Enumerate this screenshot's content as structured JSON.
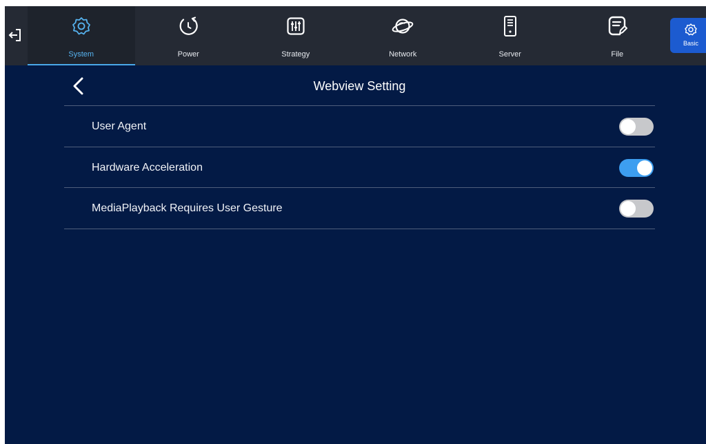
{
  "nav": {
    "items": [
      {
        "label": "System",
        "icon": "gear-icon",
        "active": true
      },
      {
        "label": "Power",
        "icon": "power-clock-icon",
        "active": false
      },
      {
        "label": "Strategy",
        "icon": "sliders-icon",
        "active": false
      },
      {
        "label": "Network",
        "icon": "globe-network-icon",
        "active": false
      },
      {
        "label": "Server",
        "icon": "server-icon",
        "active": false
      },
      {
        "label": "File",
        "icon": "file-edit-icon",
        "active": false
      }
    ],
    "basic_label": "Basic"
  },
  "page": {
    "title": "Webview Setting"
  },
  "settings": [
    {
      "label": "User Agent",
      "enabled": false
    },
    {
      "label": "Hardware Acceleration",
      "enabled": true
    },
    {
      "label": "MediaPlayback Requires User Gesture",
      "enabled": false
    }
  ],
  "colors": {
    "background": "#031a45",
    "topbar": "#252a34",
    "accent": "#56b3f0",
    "toggle_on": "#3d9ef0",
    "toggle_off": "#c7c8cb",
    "basic_button": "#1c5bd0"
  }
}
